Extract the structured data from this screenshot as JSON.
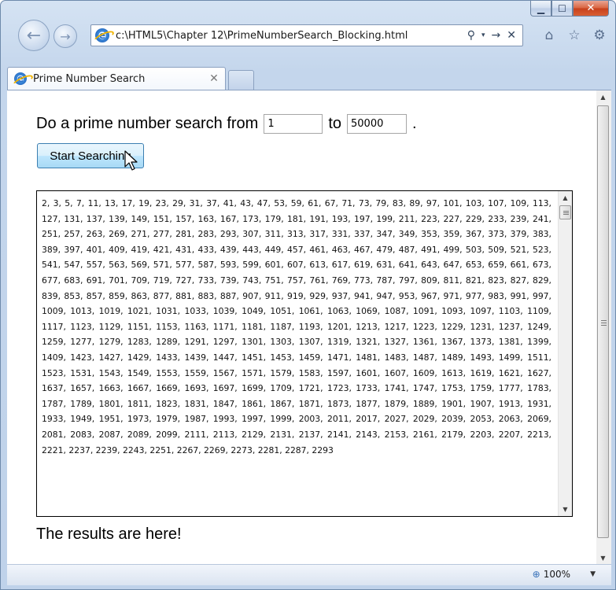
{
  "browser": {
    "address": "c:\\HTML5\\Chapter 12\\PrimeNumberSearch_Blocking.html",
    "tab_title": "Prime Number Search",
    "zoom": "100%"
  },
  "page": {
    "prompt_text": "Do a prime number search from",
    "to_text": "to",
    "from_value": "1",
    "to_value": "50000",
    "period": ".",
    "button_label": "Start Searching",
    "results_text": "2, 3, 5, 7, 11, 13, 17, 19, 23, 29, 31, 37, 41, 43, 47, 53, 59, 61, 67, 71, 73, 79, 83, 89, 97, 101, 103, 107, 109, 113, 127, 131, 137, 139, 149, 151, 157, 163, 167, 173, 179, 181, 191, 193, 197, 199, 211, 223, 227, 229, 233, 239, 241, 251, 257, 263, 269, 271, 277, 281, 283, 293, 307, 311, 313, 317, 331, 337, 347, 349, 353, 359, 367, 373, 379, 383, 389, 397, 401, 409, 419, 421, 431, 433, 439, 443, 449, 457, 461, 463, 467, 479, 487, 491, 499, 503, 509, 521, 523, 541, 547, 557, 563, 569, 571, 577, 587, 593, 599, 601, 607, 613, 617, 619, 631, 641, 643, 647, 653, 659, 661, 673, 677, 683, 691, 701, 709, 719, 727, 733, 739, 743, 751, 757, 761, 769, 773, 787, 797, 809, 811, 821, 823, 827, 829, 839, 853, 857, 859, 863, 877, 881, 883, 887, 907, 911, 919, 929, 937, 941, 947, 953, 967, 971, 977, 983, 991, 997, 1009, 1013, 1019, 1021, 1031, 1033, 1039, 1049, 1051, 1061, 1063, 1069, 1087, 1091, 1093, 1097, 1103, 1109, 1117, 1123, 1129, 1151, 1153, 1163, 1171, 1181, 1187, 1193, 1201, 1213, 1217, 1223, 1229, 1231, 1237, 1249, 1259, 1277, 1279, 1283, 1289, 1291, 1297, 1301, 1303, 1307, 1319, 1321, 1327, 1361, 1367, 1373, 1381, 1399, 1409, 1423, 1427, 1429, 1433, 1439, 1447, 1451, 1453, 1459, 1471, 1481, 1483, 1487, 1489, 1493, 1499, 1511, 1523, 1531, 1543, 1549, 1553, 1559, 1567, 1571, 1579, 1583, 1597, 1601, 1607, 1609, 1613, 1619, 1621, 1627, 1637, 1657, 1663, 1667, 1669, 1693, 1697, 1699, 1709, 1721, 1723, 1733, 1741, 1747, 1753, 1759, 1777, 1783, 1787, 1789, 1801, 1811, 1823, 1831, 1847, 1861, 1867, 1871, 1873, 1877, 1879, 1889, 1901, 1907, 1913, 1931, 1933, 1949, 1951, 1973, 1979, 1987, 1993, 1997, 1999, 2003, 2011, 2017, 2027, 2029, 2039, 2053, 2063, 2069, 2081, 2083, 2087, 2089, 2099, 2111, 2113, 2129, 2131, 2137, 2141, 2143, 2153, 2161, 2179, 2203, 2207, 2213, 2221, 2237, 2239, 2243, 2251, 2267, 2269, 2273, 2281, 2287, 2293",
    "results_message": "The results are here!"
  },
  "icons": {
    "back": "back-arrow-icon",
    "forward": "forward-arrow-icon",
    "page": "ie-page-icon",
    "search": "search-icon",
    "refresh": "go-arrow-icon",
    "stop": "stop-icon",
    "home": "home-icon",
    "favorites": "star-icon",
    "tools": "gear-icon",
    "zoom": "zoom-icon",
    "cursor": "pointer-cursor-icon"
  }
}
